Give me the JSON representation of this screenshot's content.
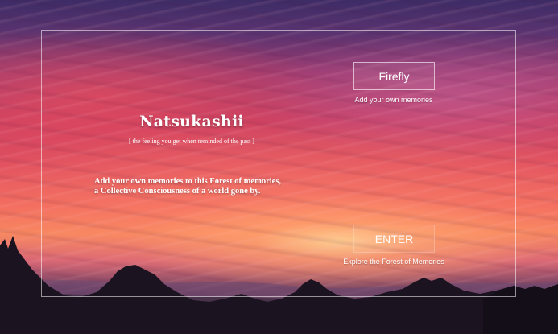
{
  "title": "Natsukashii",
  "subtitle": "[  the feeling you get when reminded of the past ]",
  "description": {
    "line1": "Add your own memories to this Forest of memories,",
    "line2": "a Collective Consciousness of a world gone by."
  },
  "firefly": {
    "label": "Firefly",
    "caption": "Add your own memories"
  },
  "enter": {
    "label": "ENTER",
    "caption": "Explore the Forest of Memories"
  },
  "colors": {
    "sky_top": "#3d2c66",
    "sky_mid": "#e2515f",
    "horizon_glow": "#f6875e",
    "text": "#ffffff"
  }
}
